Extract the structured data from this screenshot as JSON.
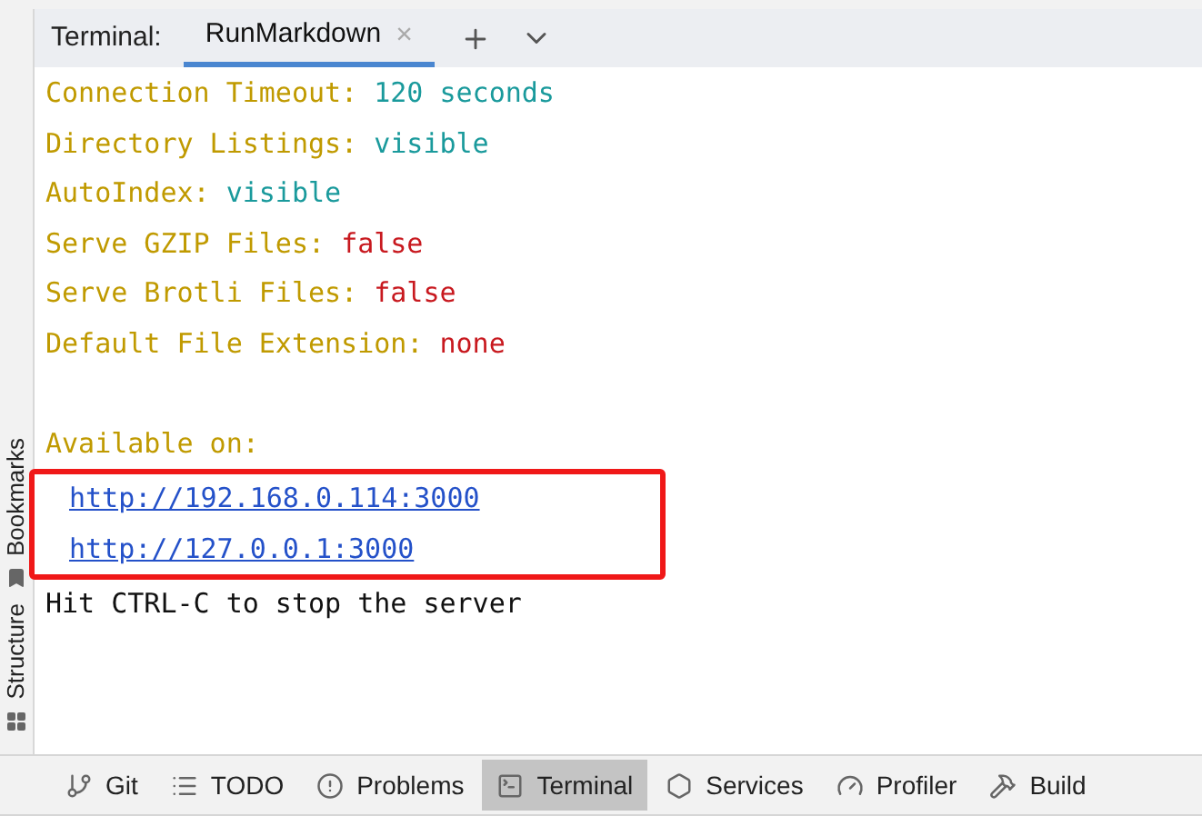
{
  "terminal_header": {
    "label": "Terminal:",
    "tabs": [
      {
        "label": "RunMarkdown",
        "selected": true,
        "close": "×"
      }
    ]
  },
  "side_tools": [
    {
      "label": "Bookmarks",
      "kind": "bookmark"
    },
    {
      "label": "Structure",
      "kind": "structure"
    }
  ],
  "output": [
    {
      "kind": "pair",
      "key": "Connection Timeout:",
      "value": "120 seconds",
      "color": "#1a9a9c"
    },
    {
      "kind": "pair",
      "key": "Directory Listings:",
      "value": "visible",
      "color": "#1a9a9c"
    },
    {
      "kind": "pair",
      "key": "AutoIndex:",
      "value": "visible",
      "color": "#1a9a9c"
    },
    {
      "kind": "pair",
      "key": "Serve GZIP Files:",
      "value": "false",
      "color": "#c8191f"
    },
    {
      "kind": "pair",
      "key": "Serve Brotli Files:",
      "value": "false",
      "color": "#c8191f"
    },
    {
      "kind": "pair",
      "key": "Default File Extension:",
      "value": "none",
      "color": "#c8191f"
    },
    {
      "kind": "blank"
    },
    {
      "kind": "heading",
      "text": "Available on:"
    },
    {
      "kind": "links",
      "highlighted": true,
      "urls": [
        "http://192.168.0.114:3000",
        "http://127.0.0.1:3000"
      ]
    },
    {
      "kind": "plain",
      "text": "Hit CTRL-C to stop the server"
    }
  ],
  "tool_windows": [
    {
      "label": "Git",
      "kind": "git",
      "selected": false
    },
    {
      "label": "TODO",
      "kind": "list",
      "selected": false
    },
    {
      "label": "Problems",
      "kind": "problems",
      "selected": false
    },
    {
      "label": "Terminal",
      "kind": "terminal",
      "selected": true
    },
    {
      "label": "Services",
      "kind": "services",
      "selected": false
    },
    {
      "label": "Profiler",
      "kind": "profiler",
      "selected": false
    },
    {
      "label": "Build",
      "kind": "build",
      "selected": false
    }
  ]
}
